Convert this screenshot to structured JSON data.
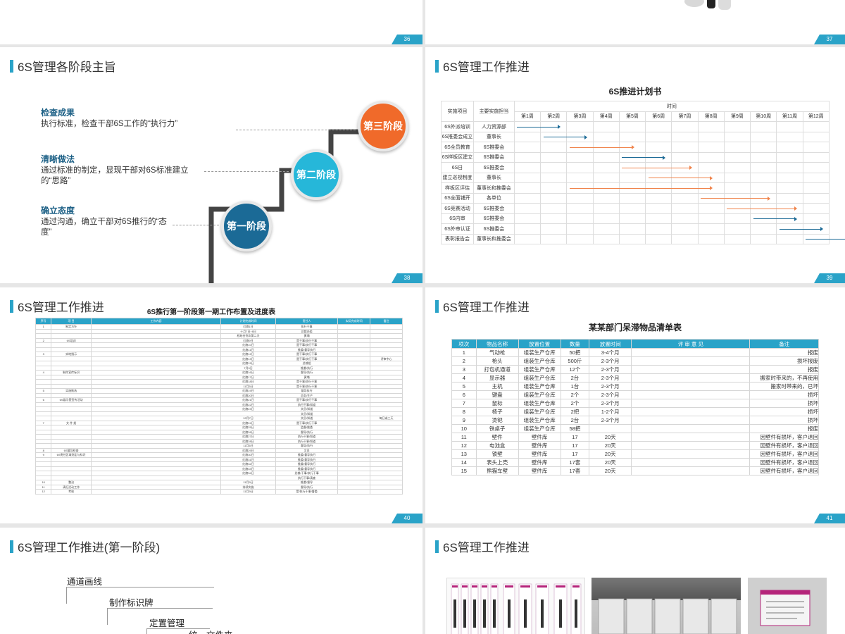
{
  "slides": {
    "s36": {
      "num": "36"
    },
    "s37": {
      "num": "37"
    },
    "s38": {
      "title": "6S管理各阶段主旨",
      "num": "38",
      "stages": [
        {
          "heading": "检查成果",
          "text": "执行标准，检查干部6S工作的“执行力”",
          "circle": "第三\n阶段"
        },
        {
          "heading": "清晰做法",
          "text": "通过标准的制定，显现干部对6S标准建立的“思路”",
          "circle": "第二\n阶段"
        },
        {
          "heading": "确立态度",
          "text": "通过沟通，确立干部对6S推行的“态度”",
          "circle": "第一\n阶段"
        }
      ]
    },
    "s39": {
      "title": "6S管理工作推进",
      "num": "39",
      "heading": "6S推进计划书",
      "col_item": "实施项目",
      "col_owner": "主要实施担当",
      "col_time": "时间",
      "weeks": [
        "第1周",
        "第2周",
        "第3周",
        "第4周",
        "第5周",
        "第6周",
        "第7周",
        "第8周",
        "第9周",
        "第10周",
        "第11周",
        "第12周"
      ],
      "rows": [
        {
          "item": "6S外派培训",
          "owner": "人力资源部",
          "bar": [
            1,
            1.8
          ],
          "color": "#1b6a96"
        },
        {
          "item": "6S推委会成立",
          "owner": "董事长",
          "bar": [
            2,
            2.8
          ],
          "color": "#1b6a96"
        },
        {
          "item": "6S全员教育",
          "owner": "6S推委会",
          "bar": [
            3,
            4.6
          ],
          "color": "#f0834a"
        },
        {
          "item": "6S样板区建立",
          "owner": "6S推委会",
          "bar": [
            5,
            5.8
          ],
          "color": "#1b6a96"
        },
        {
          "item": "6S日",
          "owner": "6S推委会",
          "bar": [
            5,
            6.8
          ],
          "color": "#f0834a"
        },
        {
          "item": "建立巡视制度",
          "owner": "董事长",
          "bar": [
            6,
            7.6
          ],
          "color": "#f0834a"
        },
        {
          "item": "样板区评估",
          "owner": "董事长和推委会",
          "bar": [
            3,
            7.6
          ],
          "color": "#f0834a"
        },
        {
          "item": "6S全面铺开",
          "owner": "各单位",
          "bar": [
            8,
            9.8
          ],
          "color": "#f0834a"
        },
        {
          "item": "6S竞赛活动",
          "owner": "6S推委会",
          "bar": [
            9,
            10.8
          ],
          "color": "#f0834a"
        },
        {
          "item": "6S内审",
          "owner": "6S推委会",
          "bar": [
            10,
            10.8
          ],
          "color": "#1b6a96"
        },
        {
          "item": "6S外审认证",
          "owner": "6S推委会",
          "bar": [
            11,
            11.8
          ],
          "color": "#1b6a96"
        },
        {
          "item": "表彰报告会",
          "owner": "董事长和推委会",
          "bar": [
            12,
            12.8
          ],
          "color": "#1b6a96"
        }
      ]
    },
    "s40": {
      "title": "6S管理工作推进",
      "num": "40",
      "heading": "6S推行第一阶段第一期工作布置及进度表",
      "cols": [
        "序号",
        "项 目",
        "工作内容",
        "计划完成时间",
        "责任人",
        "实际完成时间",
        "备注"
      ],
      "rows": [
        [
          "1",
          "制定方针",
          "",
          "红旗1日",
          "执行干事",
          "",
          ""
        ],
        [
          "",
          "",
          "",
          "十月7日~8日",
          "总裁办组",
          "",
          ""
        ],
        [
          "",
          "",
          "",
          "权结合到次第二天",
          "黄埔",
          "",
          ""
        ],
        [
          "2",
          "6S培训",
          "",
          "红旗9日",
          "是干事/执行干事",
          "",
          ""
        ],
        [
          "",
          "",
          "",
          "红旗10日",
          "是干事/执行干事",
          "",
          ""
        ],
        [
          "",
          "",
          "",
          "红旗11日",
          "推委/督导执行",
          "",
          ""
        ],
        [
          "3",
          "实地指示",
          "",
          "红旗12日",
          "是干事/执行干事",
          "",
          ""
        ],
        [
          "",
          "",
          "",
          "红旗13日",
          "是干事/执行干事",
          "",
          "评审中心"
        ],
        [
          "",
          "",
          "",
          "红旗15日",
          "总裁组",
          "",
          ""
        ],
        [
          "",
          "",
          "",
          "7月9日",
          "推委/执行",
          "",
          ""
        ],
        [
          "4",
          "制作宣传标识",
          "",
          "红旗16日",
          "督导/执行",
          "",
          ""
        ],
        [
          "",
          "",
          "",
          "红旗17日",
          "黄埔",
          "",
          ""
        ],
        [
          "",
          "",
          "",
          "红旗18日",
          "是干事/执行干事",
          "",
          ""
        ],
        [
          "",
          "",
          "",
          "11月5日",
          "是干事/执行干事",
          "",
          ""
        ],
        [
          "5",
          "实施推选",
          "",
          "红旗19日",
          "督导执行",
          "",
          ""
        ],
        [
          "",
          "",
          "",
          "红旗20日",
          "总务/生产",
          "",
          ""
        ],
        [
          "6",
          "6S展示暨宣传活动",
          "",
          "红旗21日",
          "是干事/执行干事",
          "",
          ""
        ],
        [
          "",
          "",
          "",
          "红旗22日",
          "执行干事/知道",
          "",
          ""
        ],
        [
          "",
          "",
          "",
          "红旗23日",
          "文员/知道",
          "",
          ""
        ],
        [
          "",
          "",
          "",
          "",
          "文员/知道",
          "",
          ""
        ],
        [
          "",
          "",
          "",
          "12月7日",
          "文员/知道",
          "",
          "每日或三天"
        ],
        [
          "7",
          "文 件 类",
          "",
          "红旗24日",
          "是干事/执行干事",
          "",
          ""
        ],
        [
          "",
          "",
          "",
          "红旗25日",
          "监督/推委",
          "",
          ""
        ],
        [
          "",
          "",
          "",
          "红旗26日",
          "督导/执行",
          "",
          ""
        ],
        [
          "",
          "",
          "",
          "红旗27日",
          "执行干事/知道",
          "",
          ""
        ],
        [
          "",
          "",
          "",
          "红旗28日",
          "执行干事/知道",
          "",
          ""
        ],
        [
          "",
          "",
          "",
          "11月6日",
          "督导/执行",
          "",
          ""
        ],
        [
          "8",
          "6S督导检查",
          "",
          "红旗29日",
          "文员",
          "",
          ""
        ],
        [
          "9",
          "6S责任区域划定与标识",
          "",
          "红旗30日",
          "推委/督导执行",
          "",
          ""
        ],
        [
          "",
          "",
          "",
          "红旗31日",
          "推委/督导执行",
          "",
          ""
        ],
        [
          "",
          "",
          "",
          "红旗32日",
          "推委/督导执行",
          "",
          ""
        ],
        [
          "",
          "",
          "",
          "红旗33日",
          "推委/督导执行",
          "",
          ""
        ],
        [
          "",
          "",
          "",
          "红旗34日",
          "总裁/干事/执行干事",
          "",
          ""
        ],
        [
          "",
          "",
          "",
          "",
          "执行干事/清查",
          "",
          ""
        ],
        [
          "10",
          "整治",
          "",
          "11月9日",
          "推委/督导",
          "",
          ""
        ],
        [
          "11",
          "清扫活动工作",
          "",
          "持续实施",
          "督导/执行",
          "",
          ""
        ],
        [
          "12",
          "考核",
          "",
          "11月9日",
          "是/执行干事/督委",
          "",
          ""
        ]
      ]
    },
    "s41": {
      "title": "6S管理工作推进",
      "num": "41",
      "heading": "某某部门呆滞物品清单表",
      "cols": [
        "项次",
        "物品名称",
        "放置位置",
        "数量",
        "放置时间",
        "评 审 意 见",
        "备注"
      ],
      "rows": [
        [
          "1",
          "气动枪",
          "组装生产仓库",
          "50把",
          "3-4个月",
          "",
          "报废"
        ],
        [
          "2",
          "枪头",
          "组装生产仓库",
          "500斤",
          "2-3个月",
          "",
          "损坏报废"
        ],
        [
          "3",
          "打包机通道",
          "组装生产仓库",
          "12个",
          "2-3个月",
          "",
          "报废"
        ],
        [
          "4",
          "显示器",
          "组装生产仓库",
          "2台",
          "2-3个月",
          "",
          "搬家时带来的，不再使用"
        ],
        [
          "5",
          "主机",
          "组装生产仓库",
          "1台",
          "2-3个月",
          "",
          "搬家时带来的，已坏"
        ],
        [
          "6",
          "键盘",
          "组装生产仓库",
          "2个",
          "2-3个月",
          "",
          "损坏"
        ],
        [
          "7",
          "鼠标",
          "组装生产仓库",
          "2个",
          "2-3个月",
          "",
          "损坏"
        ],
        [
          "8",
          "椅子",
          "组装生产仓库",
          "2把",
          "1-2个月",
          "",
          "损坏"
        ],
        [
          "9",
          "烫钯",
          "组装生产仓库",
          "2台",
          "2-3个月",
          "",
          "损坏"
        ],
        [
          "10",
          "铁桌子",
          "组装生产仓库",
          "58把",
          "",
          "",
          "报废"
        ],
        [
          "11",
          "壁件",
          "壁件库",
          "17",
          "20天",
          "",
          "因壁件有损坏，客户退回"
        ],
        [
          "12",
          "电池盒",
          "壁件库",
          "17",
          "20天",
          "",
          "因壁件有损坏，客户退回"
        ],
        [
          "13",
          "锁壁",
          "壁件库",
          "17",
          "20天",
          "",
          "因壁件有损坏，客户退回"
        ],
        [
          "14",
          "表头上壳",
          "壁件库",
          "17套",
          "20天",
          "",
          "因壁件有损坏，客户退回"
        ],
        [
          "15",
          "熊猫车壁",
          "壁件库",
          "17套",
          "20天",
          "",
          "因壁件有损坏，客户退回"
        ]
      ]
    },
    "s42": {
      "title": "6S管理工作推进(第一阶段)",
      "tree": [
        "通道画线",
        "制作标识牌",
        "定置管理",
        "统一文件夹"
      ]
    },
    "s43": {
      "title": "6S管理工作推进",
      "photos": [
        "6S标识卡片",
        "文件柜",
        "标识牌"
      ]
    }
  }
}
